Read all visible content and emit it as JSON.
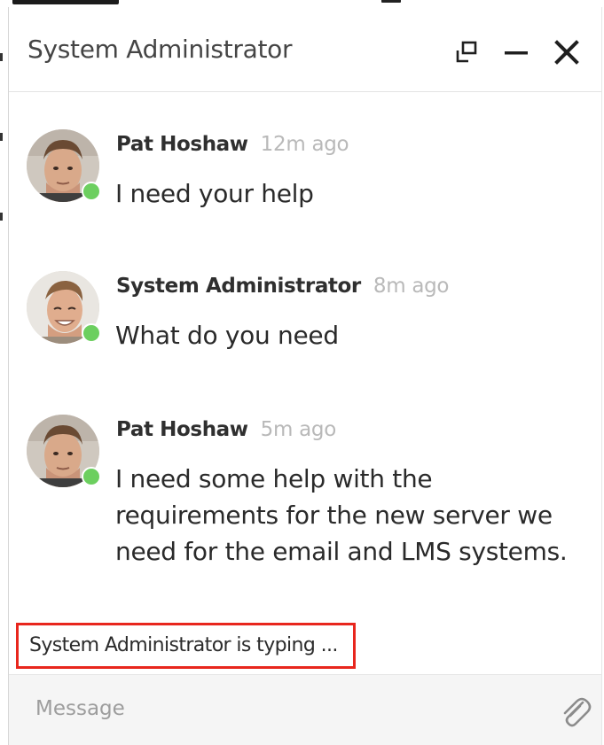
{
  "window": {
    "title": "System Administrator",
    "controls": {
      "popout_icon": "popout-icon",
      "minimize_icon": "minimize-icon",
      "close_icon": "close-icon"
    }
  },
  "messages": [
    {
      "author": "Pat Hoshaw",
      "time": "12m ago",
      "lines": [
        "I need your help"
      ],
      "presence": "online"
    },
    {
      "author": "System Administrator",
      "time": "8m ago",
      "lines": [
        "What do you need"
      ],
      "presence": "online"
    },
    {
      "author": "Pat Hoshaw",
      "time": "5m ago",
      "lines": [
        "I need some help with the",
        "requirements for the new server we",
        "need for the email and LMS systems."
      ],
      "presence": "online"
    }
  ],
  "typing_indicator": "System Administrator is typing ...",
  "composer": {
    "placeholder": "Message",
    "attach_icon": "paperclip-icon"
  },
  "colors": {
    "presence_online": "#6ccf5f",
    "highlight_border": "#e8261d",
    "timestamp": "#b9b9b9"
  }
}
